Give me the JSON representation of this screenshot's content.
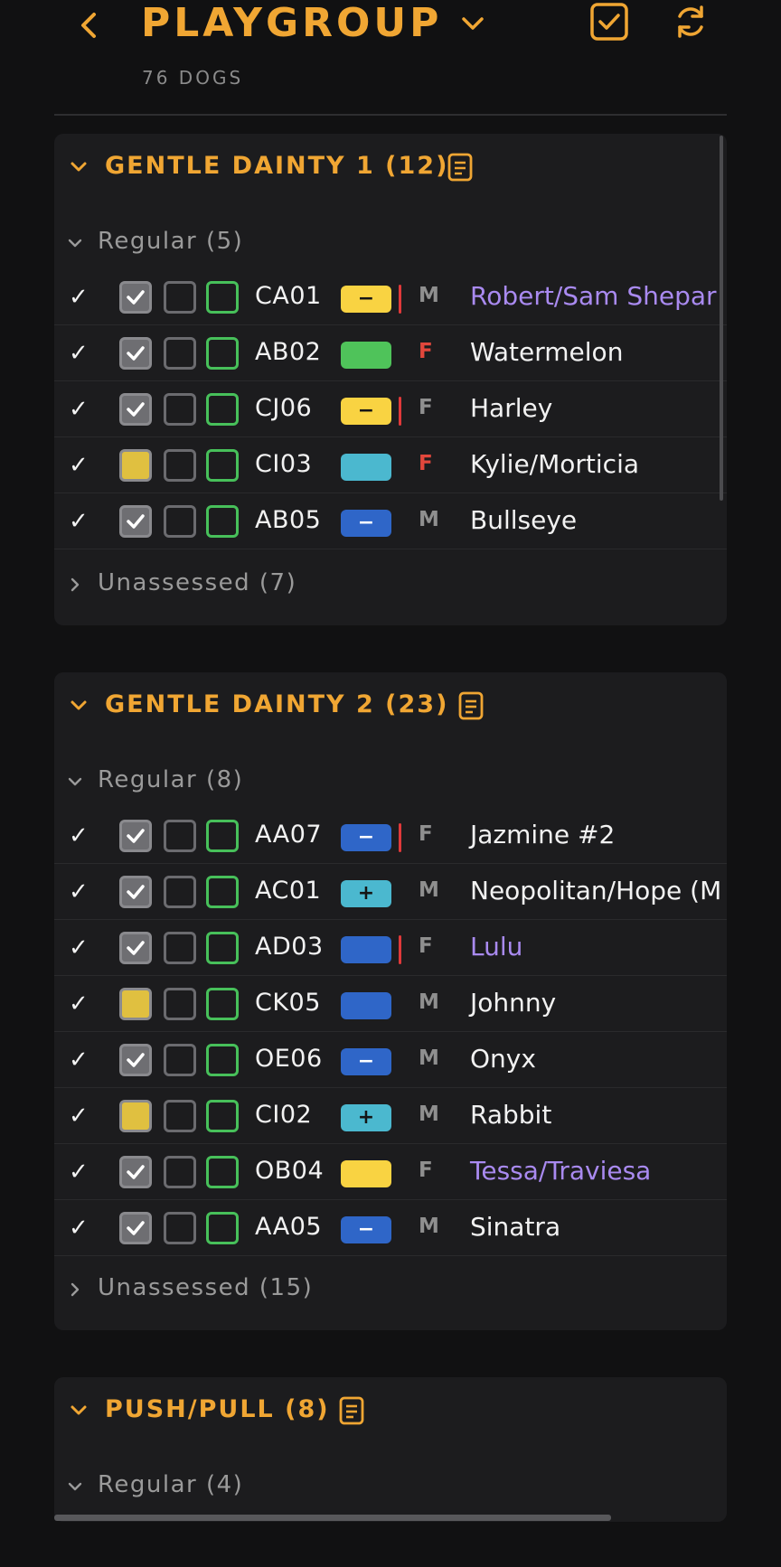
{
  "header": {
    "title": "PLAYGROUP",
    "subtitle": "76 DOGS"
  },
  "groups": [
    {
      "title": "GENTLE DAINTY 1 (12)",
      "regular_label": "Regular (5)",
      "unassessed_label": "Unassessed (7)",
      "rows": [
        {
          "code": "CA01",
          "pill": "yellow",
          "pill_symbol": "−",
          "red_mark": true,
          "sex": "M",
          "name": "Robert/Sam Shepar",
          "name_color": "purple",
          "box1": "checked"
        },
        {
          "code": "AB02",
          "pill": "green",
          "pill_symbol": "",
          "red_mark": false,
          "sex": "F",
          "name": "Watermelon",
          "name_color": "white",
          "box1": "checked"
        },
        {
          "code": "CJ06",
          "pill": "yellow",
          "pill_symbol": "−",
          "red_mark": true,
          "sex": "F",
          "name": "Harley",
          "name_color": "white",
          "box1": "checked"
        },
        {
          "code": "CI03",
          "pill": "cyan",
          "pill_symbol": "",
          "red_mark": false,
          "sex": "F",
          "name": "Kylie/Morticia",
          "name_color": "white",
          "box1": "yellow"
        },
        {
          "code": "AB05",
          "pill": "blue",
          "pill_symbol": "−",
          "red_mark": false,
          "sex": "M",
          "name": "Bullseye",
          "name_color": "white",
          "box1": "checked"
        }
      ]
    },
    {
      "title": "GENTLE DAINTY 2 (23)",
      "regular_label": "Regular (8)",
      "unassessed_label": "Unassessed (15)",
      "rows": [
        {
          "code": "AA07",
          "pill": "blue",
          "pill_symbol": "−",
          "red_mark": true,
          "sex": "F",
          "name": "Jazmine #2",
          "name_color": "white",
          "box1": "checked"
        },
        {
          "code": "AC01",
          "pill": "cyan",
          "pill_symbol": "+",
          "red_mark": false,
          "sex": "M",
          "name": "Neopolitan/Hope (M",
          "name_color": "white",
          "box1": "checked"
        },
        {
          "code": "AD03",
          "pill": "blue",
          "pill_symbol": "",
          "red_mark": true,
          "sex": "F",
          "name": "Lulu",
          "name_color": "purple",
          "box1": "checked"
        },
        {
          "code": "CK05",
          "pill": "blue",
          "pill_symbol": "",
          "red_mark": false,
          "sex": "M",
          "name": "Johnny",
          "name_color": "white",
          "box1": "yellow"
        },
        {
          "code": "OE06",
          "pill": "blue",
          "pill_symbol": "−",
          "red_mark": false,
          "sex": "M",
          "name": "Onyx",
          "name_color": "white",
          "box1": "checked"
        },
        {
          "code": "CI02",
          "pill": "cyan",
          "pill_symbol": "+",
          "red_mark": false,
          "sex": "M",
          "name": "Rabbit",
          "name_color": "white",
          "box1": "yellow"
        },
        {
          "code": "OB04",
          "pill": "yellow",
          "pill_symbol": "",
          "red_mark": false,
          "sex": "F",
          "name": "Tessa/Traviesa",
          "name_color": "purple",
          "box1": "checked"
        },
        {
          "code": "AA05",
          "pill": "blue",
          "pill_symbol": "−",
          "red_mark": false,
          "sex": "M",
          "name": "Sinatra",
          "name_color": "white",
          "box1": "checked"
        }
      ]
    },
    {
      "title": "PUSH/PULL (8)",
      "regular_label": "Regular (4)"
    }
  ],
  "colors": {
    "accent": "#f0a633",
    "purple_name": "#a98af0",
    "female_red": "#e2473c",
    "card_bg": "#1c1c1e",
    "page_bg": "#111112"
  },
  "icons": {
    "back": "chevron-left-icon",
    "dropdown": "chevron-down-icon",
    "select_all": "checkbox-checked-icon",
    "refresh": "refresh-icon",
    "notes": "notes-icon"
  }
}
